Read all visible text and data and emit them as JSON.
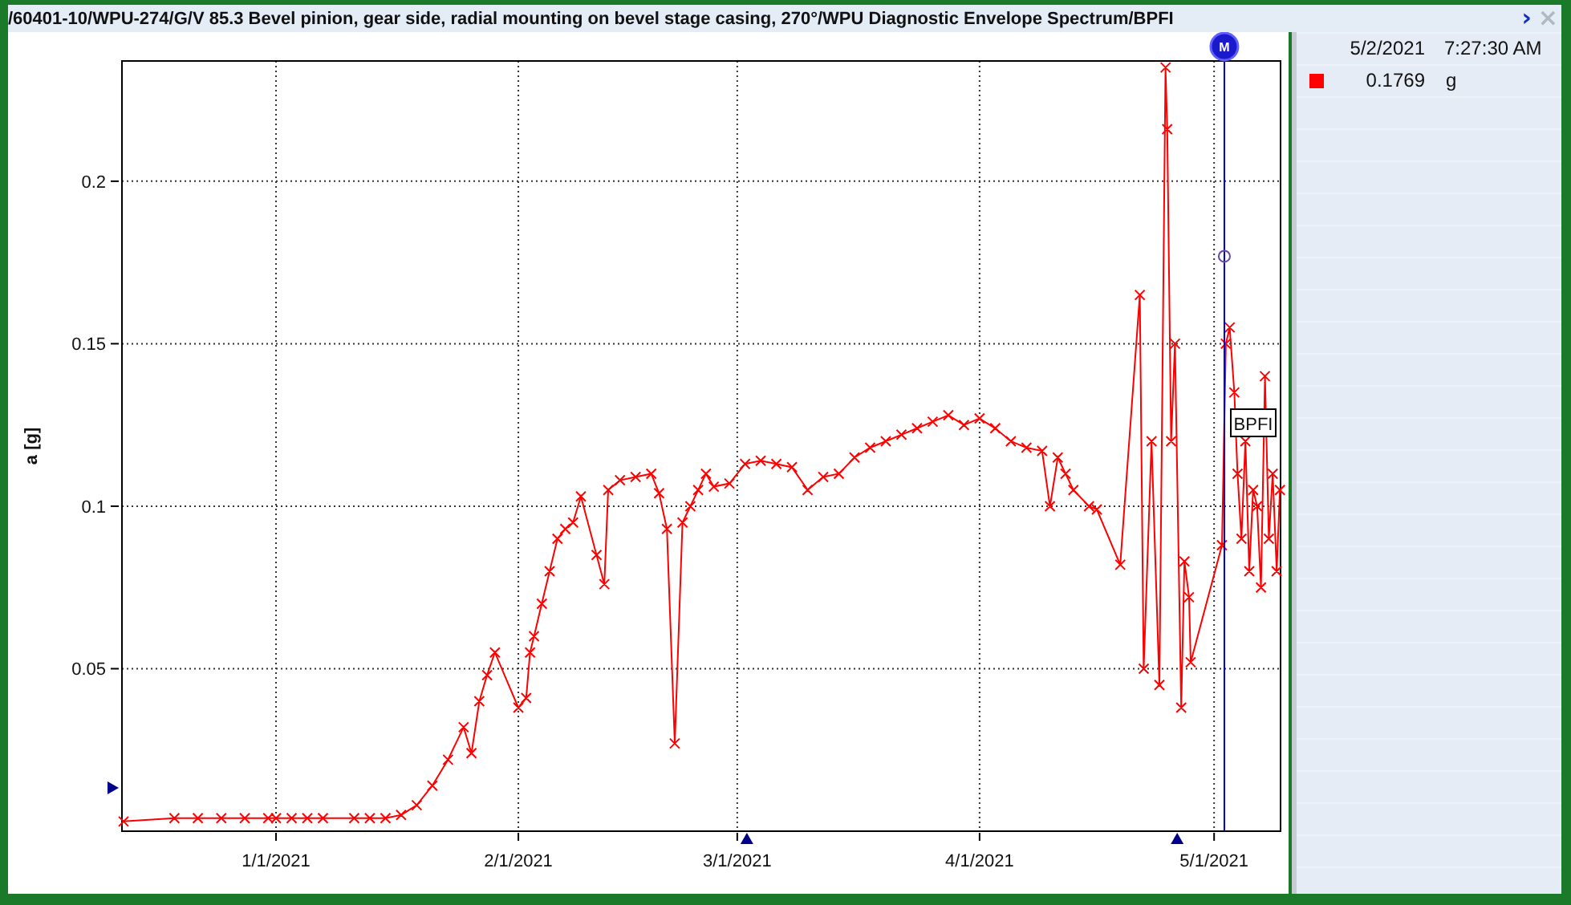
{
  "window": {
    "title": "/60401-10/WPU-274/G/V 85.3 Bevel pinion, gear side, radial mounting on bevel stage casing, 270°/WPU Diagnostic Envelope Spectrum/BPFI",
    "expand_icon": "›",
    "close_icon": "×"
  },
  "chart": {
    "marker_label": "M",
    "chart_data": {
      "type": "line",
      "ylabel": "a [g]",
      "x": [
        "2020-12-12T12:00",
        "2020-12-19",
        "2020-12-22",
        "2020-12-25",
        "2020-12-28",
        "2020-12-31",
        "2021-01-01",
        "2021-01-03",
        "2021-01-05",
        "2021-01-07",
        "2021-01-11",
        "2021-01-13",
        "2021-01-15",
        "2021-01-17",
        "2021-01-19",
        "2021-01-21",
        "2021-01-23",
        "2021-01-25",
        "2021-01-26",
        "2021-01-27",
        "2021-01-28",
        "2021-01-29",
        "2021-02-01",
        "2021-02-02",
        "2021-02-02T12:00",
        "2021-02-03",
        "2021-02-04",
        "2021-02-05",
        "2021-02-06",
        "2021-02-07",
        "2021-02-08",
        "2021-02-09",
        "2021-02-11",
        "2021-02-12",
        "2021-02-12T12:00",
        "2021-02-14",
        "2021-02-16",
        "2021-02-18",
        "2021-02-19",
        "2021-02-20",
        "2021-02-21",
        "2021-02-22",
        "2021-02-23",
        "2021-02-24",
        "2021-02-25",
        "2021-02-26",
        "2021-02-28",
        "2021-03-02",
        "2021-03-04",
        "2021-03-06",
        "2021-03-08",
        "2021-03-10",
        "2021-03-12",
        "2021-03-14",
        "2021-03-16",
        "2021-03-18",
        "2021-03-20",
        "2021-03-22",
        "2021-03-24",
        "2021-03-26",
        "2021-03-28",
        "2021-03-30",
        "2021-04-01",
        "2021-04-03",
        "2021-04-05",
        "2021-04-07",
        "2021-04-09",
        "2021-04-10",
        "2021-04-11",
        "2021-04-12",
        "2021-04-13",
        "2021-04-15",
        "2021-04-16",
        "2021-04-19",
        "2021-04-21T12:00",
        "2021-04-22",
        "2021-04-23",
        "2021-04-24",
        "2021-04-24T19:00",
        "2021-04-25",
        "2021-04-25T12:00",
        "2021-04-26",
        "2021-04-26T19:00",
        "2021-04-27T05:00",
        "2021-04-27T19:00",
        "2021-04-28",
        "2021-05-02",
        "2021-05-02T12:00",
        "2021-05-03",
        "2021-05-03T14:00",
        "2021-05-04",
        "2021-05-04T12:00",
        "2021-05-05",
        "2021-05-05T12:00",
        "2021-05-06",
        "2021-05-06T12:00",
        "2021-05-07",
        "2021-05-07T12:00",
        "2021-05-08",
        "2021-05-08T12:00",
        "2021-05-09",
        "2021-05-09T10:00"
      ],
      "series": [
        {
          "name": "BPFI",
          "color": "#ff0000",
          "marker": "x",
          "values": [
            0.003,
            0.004,
            0.004,
            0.004,
            0.004,
            0.004,
            0.004,
            0.004,
            0.004,
            0.004,
            0.004,
            0.004,
            0.004,
            0.005,
            0.008,
            0.014,
            0.022,
            0.032,
            0.024,
            0.04,
            0.048,
            0.055,
            0.038,
            0.041,
            0.055,
            0.06,
            0.07,
            0.08,
            0.09,
            0.093,
            0.095,
            0.103,
            0.085,
            0.076,
            0.105,
            0.108,
            0.109,
            0.11,
            0.104,
            0.093,
            0.027,
            0.095,
            0.1,
            0.105,
            0.11,
            0.106,
            0.107,
            0.113,
            0.114,
            0.113,
            0.112,
            0.105,
            0.109,
            0.11,
            0.115,
            0.118,
            0.12,
            0.122,
            0.124,
            0.126,
            0.128,
            0.125,
            0.127,
            0.124,
            0.12,
            0.118,
            0.117,
            0.1,
            0.115,
            0.11,
            0.105,
            0.1,
            0.099,
            0.082,
            0.165,
            0.05,
            0.12,
            0.045,
            0.235,
            0.216,
            0.12,
            0.15,
            0.038,
            0.083,
            0.072,
            0.052,
            0.088,
            0.15,
            0.155,
            0.135,
            0.11,
            0.09,
            0.12,
            0.08,
            0.105,
            0.1,
            0.075,
            0.14,
            0.09,
            0.11,
            0.08,
            0.105
          ]
        }
      ],
      "xlim": [
        "2020-12-12T07:00",
        "2021-05-09T12:00"
      ],
      "ylim": [
        0,
        0.237
      ],
      "xticks": [
        {
          "value": "2021-01-01",
          "label": "1/1/2021"
        },
        {
          "value": "2021-02-01",
          "label": "2/1/2021"
        },
        {
          "value": "2021-03-01",
          "label": "3/1/2021"
        },
        {
          "value": "2021-04-01",
          "label": "4/1/2021"
        },
        {
          "value": "2021-05-01",
          "label": "5/1/2021"
        }
      ],
      "yticks": [
        0.05,
        0.1,
        0.15,
        0.2
      ],
      "grid": true,
      "ref_lines": [
        {
          "axis": "x",
          "value": "2021-05-02T07:27",
          "color": "#0000cc"
        }
      ]
    }
  },
  "legend": {
    "date": "5/2/2021",
    "time": "7:27:30 AM",
    "value": "0.1769",
    "unit": "g",
    "color": "#ff0000"
  }
}
